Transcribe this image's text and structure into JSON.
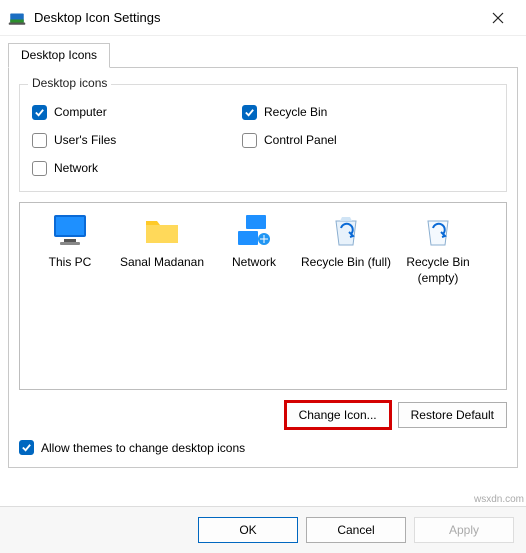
{
  "window": {
    "title": "Desktop Icon Settings"
  },
  "tabs": {
    "main": "Desktop Icons"
  },
  "group": {
    "title": "Desktop icons",
    "computer": "Computer",
    "users_files": "User's Files",
    "network": "Network",
    "recycle_bin": "Recycle Bin",
    "control_panel": "Control Panel"
  },
  "checks": {
    "computer": true,
    "users_files": false,
    "network": false,
    "recycle_bin": true,
    "control_panel": false,
    "allow_themes": true
  },
  "icons": {
    "this_pc": "This PC",
    "user_folder": "Sanal Madanan",
    "network": "Network",
    "recycle_full": "Recycle Bin (full)",
    "recycle_empty": "Recycle Bin (empty)"
  },
  "buttons": {
    "change_icon": "Change Icon...",
    "restore_default": "Restore Default",
    "ok": "OK",
    "cancel": "Cancel",
    "apply": "Apply"
  },
  "themes_label": "Allow themes to change desktop icons",
  "watermark": "wsxdn.com"
}
